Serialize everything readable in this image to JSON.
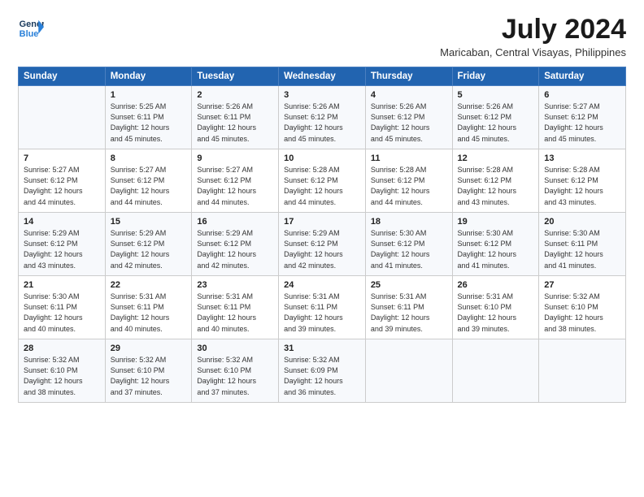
{
  "logo": {
    "line1": "General",
    "line2": "Blue"
  },
  "title": "July 2024",
  "subtitle": "Maricaban, Central Visayas, Philippines",
  "days_header": [
    "Sunday",
    "Monday",
    "Tuesday",
    "Wednesday",
    "Thursday",
    "Friday",
    "Saturday"
  ],
  "weeks": [
    [
      {
        "day": "",
        "info": ""
      },
      {
        "day": "1",
        "info": "Sunrise: 5:25 AM\nSunset: 6:11 PM\nDaylight: 12 hours\nand 45 minutes."
      },
      {
        "day": "2",
        "info": "Sunrise: 5:26 AM\nSunset: 6:11 PM\nDaylight: 12 hours\nand 45 minutes."
      },
      {
        "day": "3",
        "info": "Sunrise: 5:26 AM\nSunset: 6:12 PM\nDaylight: 12 hours\nand 45 minutes."
      },
      {
        "day": "4",
        "info": "Sunrise: 5:26 AM\nSunset: 6:12 PM\nDaylight: 12 hours\nand 45 minutes."
      },
      {
        "day": "5",
        "info": "Sunrise: 5:26 AM\nSunset: 6:12 PM\nDaylight: 12 hours\nand 45 minutes."
      },
      {
        "day": "6",
        "info": "Sunrise: 5:27 AM\nSunset: 6:12 PM\nDaylight: 12 hours\nand 45 minutes."
      }
    ],
    [
      {
        "day": "7",
        "info": "Sunrise: 5:27 AM\nSunset: 6:12 PM\nDaylight: 12 hours\nand 44 minutes."
      },
      {
        "day": "8",
        "info": "Sunrise: 5:27 AM\nSunset: 6:12 PM\nDaylight: 12 hours\nand 44 minutes."
      },
      {
        "day": "9",
        "info": "Sunrise: 5:27 AM\nSunset: 6:12 PM\nDaylight: 12 hours\nand 44 minutes."
      },
      {
        "day": "10",
        "info": "Sunrise: 5:28 AM\nSunset: 6:12 PM\nDaylight: 12 hours\nand 44 minutes."
      },
      {
        "day": "11",
        "info": "Sunrise: 5:28 AM\nSunset: 6:12 PM\nDaylight: 12 hours\nand 44 minutes."
      },
      {
        "day": "12",
        "info": "Sunrise: 5:28 AM\nSunset: 6:12 PM\nDaylight: 12 hours\nand 43 minutes."
      },
      {
        "day": "13",
        "info": "Sunrise: 5:28 AM\nSunset: 6:12 PM\nDaylight: 12 hours\nand 43 minutes."
      }
    ],
    [
      {
        "day": "14",
        "info": "Sunrise: 5:29 AM\nSunset: 6:12 PM\nDaylight: 12 hours\nand 43 minutes."
      },
      {
        "day": "15",
        "info": "Sunrise: 5:29 AM\nSunset: 6:12 PM\nDaylight: 12 hours\nand 42 minutes."
      },
      {
        "day": "16",
        "info": "Sunrise: 5:29 AM\nSunset: 6:12 PM\nDaylight: 12 hours\nand 42 minutes."
      },
      {
        "day": "17",
        "info": "Sunrise: 5:29 AM\nSunset: 6:12 PM\nDaylight: 12 hours\nand 42 minutes."
      },
      {
        "day": "18",
        "info": "Sunrise: 5:30 AM\nSunset: 6:12 PM\nDaylight: 12 hours\nand 41 minutes."
      },
      {
        "day": "19",
        "info": "Sunrise: 5:30 AM\nSunset: 6:12 PM\nDaylight: 12 hours\nand 41 minutes."
      },
      {
        "day": "20",
        "info": "Sunrise: 5:30 AM\nSunset: 6:11 PM\nDaylight: 12 hours\nand 41 minutes."
      }
    ],
    [
      {
        "day": "21",
        "info": "Sunrise: 5:30 AM\nSunset: 6:11 PM\nDaylight: 12 hours\nand 40 minutes."
      },
      {
        "day": "22",
        "info": "Sunrise: 5:31 AM\nSunset: 6:11 PM\nDaylight: 12 hours\nand 40 minutes."
      },
      {
        "day": "23",
        "info": "Sunrise: 5:31 AM\nSunset: 6:11 PM\nDaylight: 12 hours\nand 40 minutes."
      },
      {
        "day": "24",
        "info": "Sunrise: 5:31 AM\nSunset: 6:11 PM\nDaylight: 12 hours\nand 39 minutes."
      },
      {
        "day": "25",
        "info": "Sunrise: 5:31 AM\nSunset: 6:11 PM\nDaylight: 12 hours\nand 39 minutes."
      },
      {
        "day": "26",
        "info": "Sunrise: 5:31 AM\nSunset: 6:10 PM\nDaylight: 12 hours\nand 39 minutes."
      },
      {
        "day": "27",
        "info": "Sunrise: 5:32 AM\nSunset: 6:10 PM\nDaylight: 12 hours\nand 38 minutes."
      }
    ],
    [
      {
        "day": "28",
        "info": "Sunrise: 5:32 AM\nSunset: 6:10 PM\nDaylight: 12 hours\nand 38 minutes."
      },
      {
        "day": "29",
        "info": "Sunrise: 5:32 AM\nSunset: 6:10 PM\nDaylight: 12 hours\nand 37 minutes."
      },
      {
        "day": "30",
        "info": "Sunrise: 5:32 AM\nSunset: 6:10 PM\nDaylight: 12 hours\nand 37 minutes."
      },
      {
        "day": "31",
        "info": "Sunrise: 5:32 AM\nSunset: 6:09 PM\nDaylight: 12 hours\nand 36 minutes."
      },
      {
        "day": "",
        "info": ""
      },
      {
        "day": "",
        "info": ""
      },
      {
        "day": "",
        "info": ""
      }
    ]
  ]
}
